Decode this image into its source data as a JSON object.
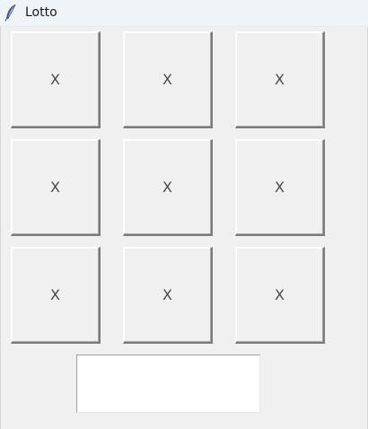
{
  "window": {
    "title": "Lotto",
    "icon": "feather-icon"
  },
  "grid": {
    "cells": [
      "X",
      "X",
      "X",
      "X",
      "X",
      "X",
      "X",
      "X",
      "X"
    ]
  },
  "entry": {
    "value": ""
  }
}
